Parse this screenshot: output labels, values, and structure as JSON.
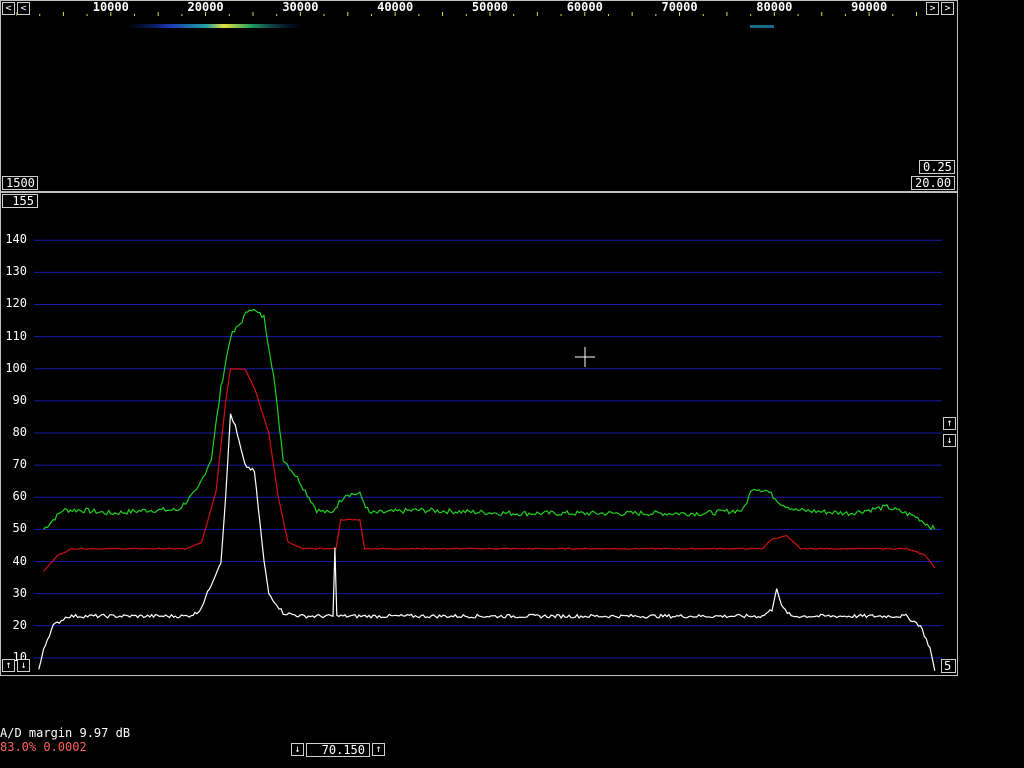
{
  "window": {
    "icons": {
      "scroll_left": "chevron-left-icon",
      "scroll_right": "chevron-right-icon",
      "up": "arrow-up-icon",
      "down": "arrow-down-icon",
      "crosshair": "crosshair-icon"
    }
  },
  "waterfall": {
    "freq_labels": [
      "10000",
      "20000",
      "30000",
      "40000",
      "50000",
      "60000",
      "70000",
      "80000",
      "90000"
    ],
    "left_box": "1500",
    "gain_box": "0.25",
    "zero_box": "20.00"
  },
  "spectrum": {
    "top_box": "155",
    "avg_box": "5",
    "y_labels": [
      "140",
      "130",
      "120",
      "110",
      "100",
      "90",
      "80",
      "70",
      "60",
      "50",
      "40",
      "30",
      "20",
      "10"
    ]
  },
  "status": {
    "ad_margin": "A/D margin 9.97 dB",
    "load": "83.0% 0.0002",
    "freq_value": "70.150"
  },
  "colors": {
    "grid": "#1a1aa8",
    "trace_peak": "#1ed01e",
    "trace_avg": "#d01010",
    "trace_live": "#ffffff",
    "load_text": "#ff6060"
  },
  "chart_data": {
    "type": "line",
    "ylim": [
      5,
      155
    ],
    "xlim": [
      0,
      96000
    ],
    "yticks": [
      10,
      20,
      30,
      40,
      50,
      60,
      70,
      80,
      90,
      100,
      110,
      120,
      130,
      140
    ],
    "xticks": [
      10000,
      20000,
      30000,
      40000,
      50000,
      60000,
      70000,
      80000,
      90000
    ],
    "series": [
      {
        "color": "#1ed01e",
        "points": [
          [
            1000,
            50
          ],
          [
            3000,
            56
          ],
          [
            5000,
            56
          ],
          [
            8000,
            55
          ],
          [
            12000,
            56
          ],
          [
            15000,
            56
          ],
          [
            17000,
            62
          ],
          [
            18500,
            72
          ],
          [
            19500,
            94
          ],
          [
            20500,
            110
          ],
          [
            21500,
            114
          ],
          [
            22500,
            119
          ],
          [
            24000,
            116
          ],
          [
            25000,
            98
          ],
          [
            26000,
            72
          ],
          [
            27500,
            66
          ],
          [
            29500,
            56
          ],
          [
            31000,
            55
          ],
          [
            32500,
            61
          ],
          [
            34000,
            61
          ],
          [
            35000,
            55
          ],
          [
            40000,
            56
          ],
          [
            50000,
            55
          ],
          [
            60000,
            55
          ],
          [
            70000,
            55
          ],
          [
            74000,
            56
          ],
          [
            75000,
            63
          ],
          [
            76500,
            62
          ],
          [
            78000,
            58
          ],
          [
            79500,
            56
          ],
          [
            85000,
            55
          ],
          [
            89000,
            57
          ],
          [
            92000,
            54
          ],
          [
            94000,
            50
          ]
        ]
      },
      {
        "color": "#d01010",
        "points": [
          [
            1000,
            37
          ],
          [
            2500,
            42
          ],
          [
            4000,
            44
          ],
          [
            10000,
            44
          ],
          [
            16000,
            44
          ],
          [
            17500,
            46
          ],
          [
            19000,
            62
          ],
          [
            20000,
            90
          ],
          [
            20500,
            100
          ],
          [
            22000,
            100
          ],
          [
            23000,
            94
          ],
          [
            24500,
            80
          ],
          [
            25500,
            60
          ],
          [
            26500,
            46
          ],
          [
            28000,
            44
          ],
          [
            31500,
            44
          ],
          [
            32000,
            53
          ],
          [
            34000,
            53
          ],
          [
            34500,
            44
          ],
          [
            40000,
            44
          ],
          [
            50000,
            44
          ],
          [
            60000,
            44
          ],
          [
            70000,
            44
          ],
          [
            76000,
            44
          ],
          [
            77000,
            47
          ],
          [
            78500,
            48
          ],
          [
            80000,
            44
          ],
          [
            85000,
            44
          ],
          [
            91000,
            44
          ],
          [
            93000,
            42
          ],
          [
            94000,
            38
          ]
        ]
      },
      {
        "color": "#ffffff",
        "points": [
          [
            500,
            6
          ],
          [
            1000,
            13
          ],
          [
            2000,
            20
          ],
          [
            3500,
            23
          ],
          [
            10000,
            23
          ],
          [
            16000,
            23
          ],
          [
            17000,
            24
          ],
          [
            17500,
            26
          ],
          [
            18500,
            33
          ],
          [
            19500,
            40
          ],
          [
            20000,
            60
          ],
          [
            20500,
            86
          ],
          [
            21000,
            82
          ],
          [
            22000,
            70
          ],
          [
            23000,
            68
          ],
          [
            24000,
            40
          ],
          [
            24500,
            30
          ],
          [
            26000,
            24
          ],
          [
            28000,
            23
          ],
          [
            31200,
            23
          ],
          [
            31400,
            44
          ],
          [
            31600,
            23
          ],
          [
            40000,
            23
          ],
          [
            50000,
            23
          ],
          [
            60000,
            23
          ],
          [
            70000,
            23
          ],
          [
            76000,
            23
          ],
          [
            77000,
            25
          ],
          [
            77500,
            32
          ],
          [
            78000,
            26
          ],
          [
            79000,
            23
          ],
          [
            85000,
            23
          ],
          [
            91000,
            23
          ],
          [
            92500,
            20
          ],
          [
            93500,
            13
          ],
          [
            94000,
            6
          ]
        ]
      }
    ]
  }
}
